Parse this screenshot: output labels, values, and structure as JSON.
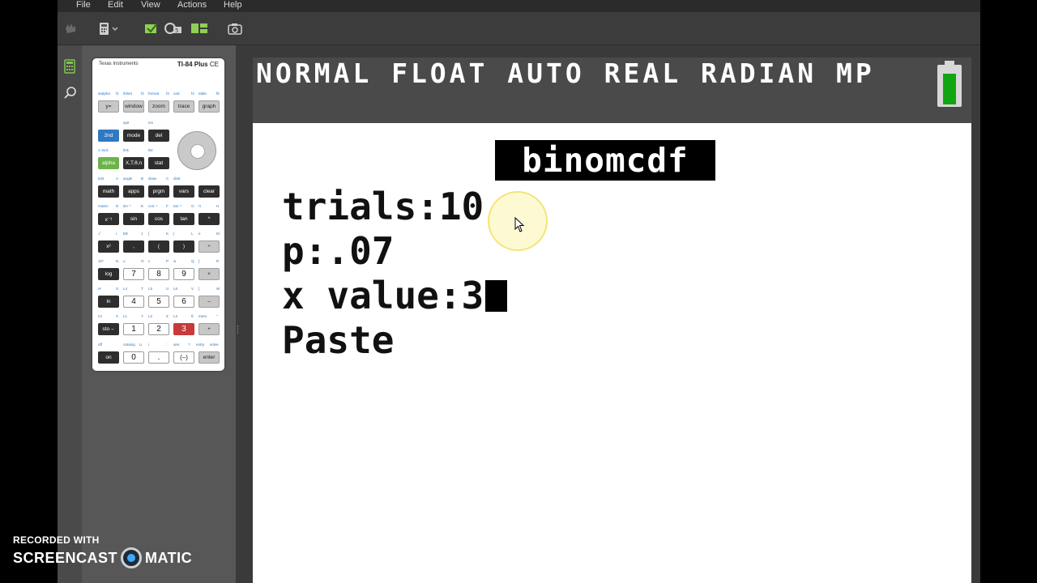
{
  "menu": [
    "File",
    "Edit",
    "View",
    "Actions",
    "Help"
  ],
  "calculator": {
    "brand": "Texas Instruments",
    "model": "TI-84 Plus",
    "model_suffix": "CE",
    "keys": {
      "row1": [
        "y=",
        "window",
        "zoom",
        "trace",
        "graph"
      ],
      "second": "2nd",
      "mode": "mode",
      "del": "del",
      "alpha": "alpha",
      "xton": "X,T,θ,n",
      "stat": "stat",
      "row4": [
        "math",
        "apps",
        "prgm",
        "vars",
        "clear"
      ],
      "row5": [
        "x⁻¹",
        "sin",
        "cos",
        "tan",
        "^"
      ],
      "row6": [
        "x²",
        ",",
        "(",
        ")",
        "÷"
      ],
      "row7": [
        "log",
        "7",
        "8",
        "9",
        "×"
      ],
      "row8": [
        "ln",
        "4",
        "5",
        "6",
        "–"
      ],
      "row9": [
        "sto→",
        "1",
        "2",
        "3",
        "+"
      ],
      "row10": [
        "on",
        "0",
        ".",
        "(–)",
        "enter"
      ]
    },
    "labels": {
      "r1": [
        "statplot",
        "f1",
        "tblset",
        "f2",
        "format",
        "f3",
        "calc",
        "f4",
        "table",
        "f5"
      ],
      "r2": [
        "quit",
        "ins"
      ],
      "r3": [
        "A-lock",
        "link",
        "list"
      ],
      "r4": [
        "test",
        "A",
        "angle",
        "B",
        "draw",
        "C",
        "distr"
      ],
      "r5": [
        "matrix",
        "D",
        "sin⁻¹",
        "E",
        "cos⁻¹",
        "F",
        "tan⁻¹",
        "G",
        "π",
        "H"
      ],
      "r6": [
        "√‾",
        "I",
        "EE",
        "J",
        "{",
        "K",
        "}",
        "L",
        "e",
        "M"
      ],
      "r7": [
        "10ˣ",
        "N",
        "u",
        "O",
        "v",
        "P",
        "w",
        "Q",
        "[",
        "R"
      ],
      "r8": [
        "eˣ",
        "S",
        "L4",
        "T",
        "L5",
        "U",
        "L6",
        "V",
        "]",
        "W"
      ],
      "r9": [
        "rcl",
        "X",
        "L1",
        "Y",
        "L2",
        "Z",
        "L3",
        "θ",
        "mem",
        "\""
      ],
      "r10": [
        "off",
        "catalog",
        "⊔",
        "i",
        ":",
        "ans",
        "?",
        "entry",
        "solve"
      ]
    }
  },
  "screen": {
    "status": "NORMAL FLOAT AUTO REAL RADIAN MP",
    "function_title": "binomcdf",
    "lines": {
      "trials": "trials:10",
      "p": "p:.07",
      "xvalue": "x value:3",
      "paste": "Paste"
    }
  },
  "watermark": {
    "recorded_with": "RECORDED WITH",
    "brand_left": "SCREENCAST",
    "brand_right": "MATIC"
  },
  "colors": {
    "battery": "#12a512",
    "second_key": "#2f79c2",
    "alpha_key": "#6bb34a",
    "highlight_key": "#c83a3a"
  }
}
